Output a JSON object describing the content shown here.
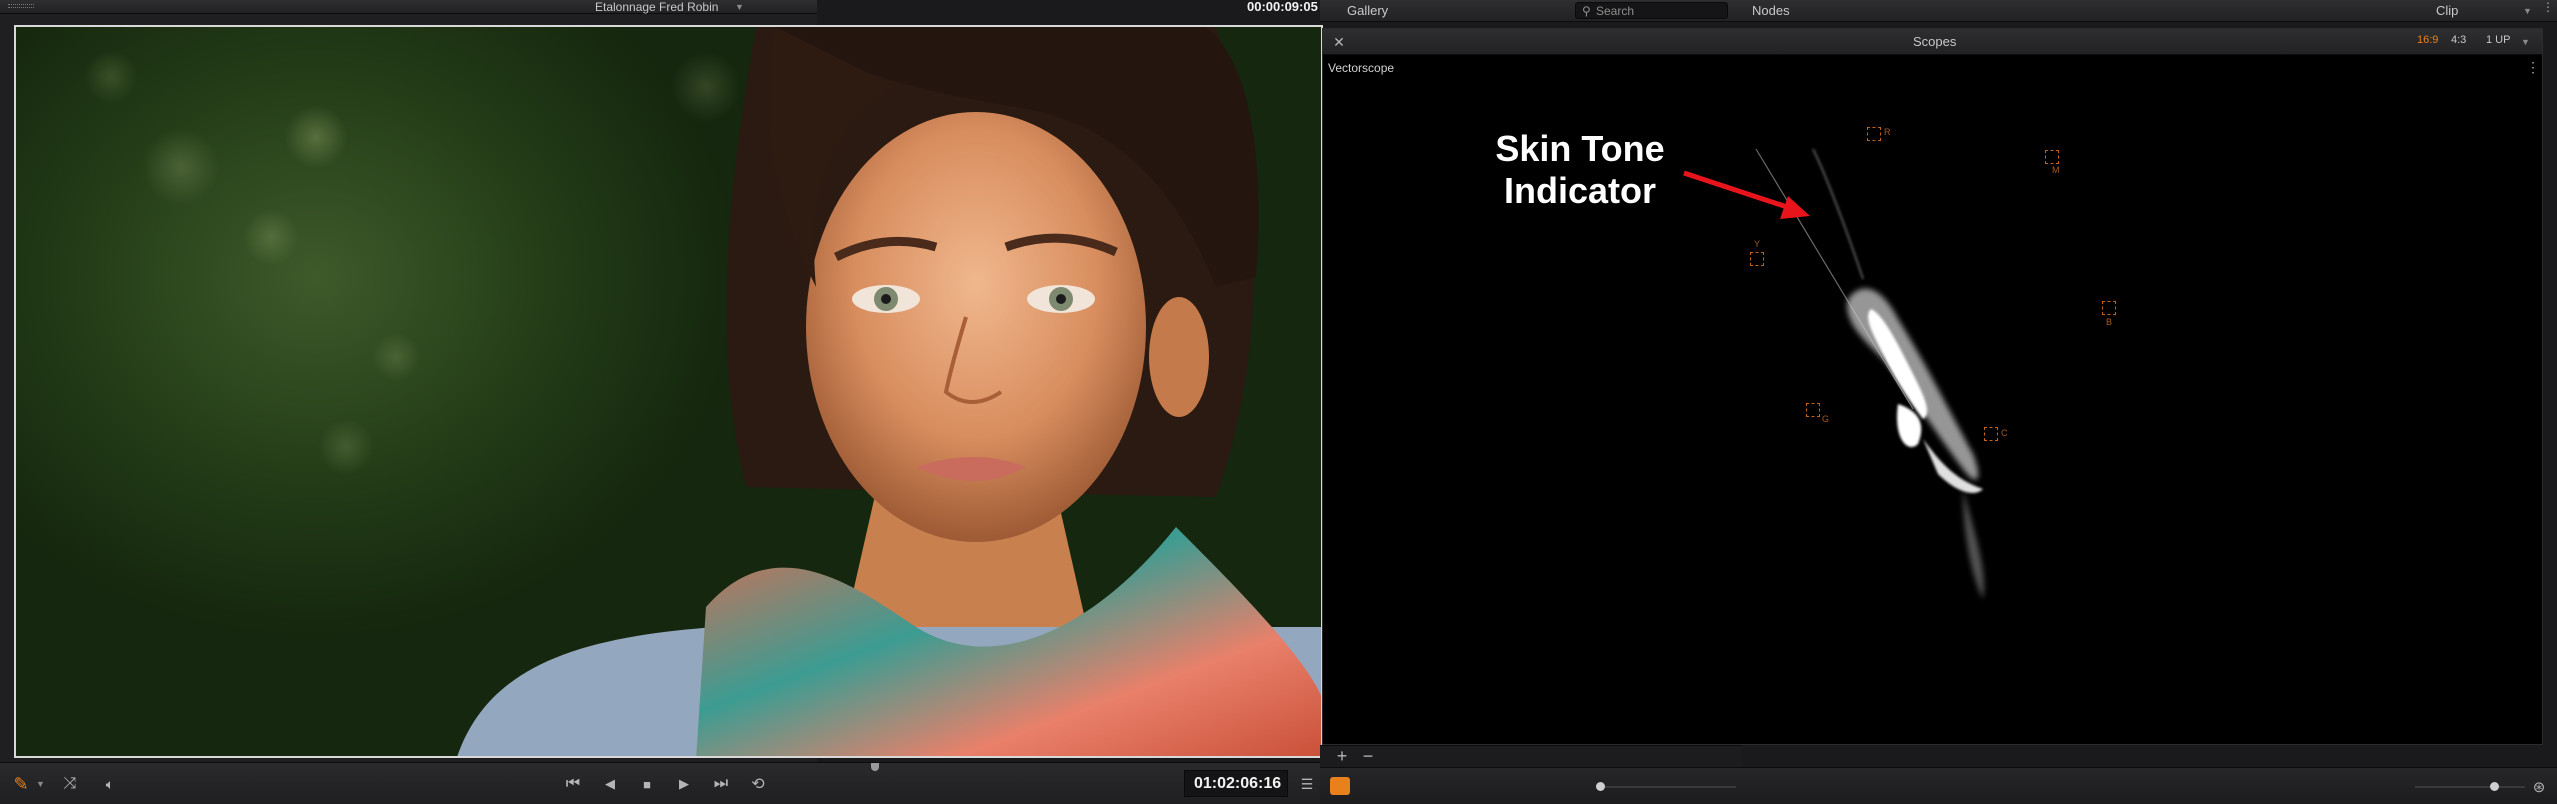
{
  "viewer": {
    "project_title": "Etalonnage Fred Robin",
    "source_timecode": "00:00:09:05",
    "record_timecode": "01:02:06:16"
  },
  "gallery": {
    "title": "Gallery",
    "search_placeholder": "Search"
  },
  "nodes": {
    "title": "Nodes",
    "clip_label": "Clip"
  },
  "scopes": {
    "title": "Scopes",
    "aspect_16_9": "16:9",
    "aspect_4_3": "4:3",
    "layout": "1 UP",
    "scope_name": "Vectorscope",
    "targets": [
      {
        "label": "R"
      },
      {
        "label": "M"
      },
      {
        "label": "Y"
      },
      {
        "label": "B"
      },
      {
        "label": "G"
      },
      {
        "label": "C"
      }
    ]
  },
  "annotation": {
    "line1": "Skin Tone",
    "line2": "Indicator"
  },
  "colors": {
    "accent_orange": "#e8801c",
    "annotation_arrow": "#e8141c",
    "target_orange": "#c0641c"
  }
}
